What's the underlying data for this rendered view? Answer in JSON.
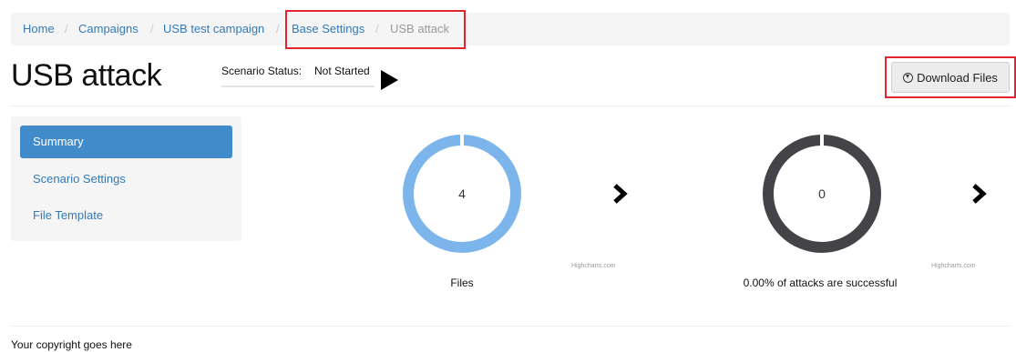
{
  "breadcrumb": {
    "items": [
      "Home",
      "Campaigns",
      "USB test campaign",
      "Base Settings",
      "USB attack"
    ],
    "separator": "/"
  },
  "header": {
    "title": "USB attack",
    "status_label": "Scenario Status:",
    "status_value": "Not Started",
    "download_label": "Download Files"
  },
  "sidebar": {
    "items": [
      {
        "label": "Summary",
        "active": true
      },
      {
        "label": "Scenario Settings",
        "active": false
      },
      {
        "label": "File Template",
        "active": false
      }
    ]
  },
  "charts": [
    {
      "value": "4",
      "caption": "Files",
      "credits": "Highcharts.com",
      "color": "#7cb5ec"
    },
    {
      "value": "0",
      "caption": "0.00% of attacks are successful",
      "credits": "Highcharts.com",
      "color": "#434348"
    }
  ],
  "chart_data": [
    {
      "type": "pie",
      "categories": [
        "Files"
      ],
      "values": [
        4
      ],
      "title": "",
      "center_label": "4"
    },
    {
      "type": "pie",
      "categories": [
        "attacks"
      ],
      "values": [
        0
      ],
      "title": "",
      "center_label": "0"
    }
  ],
  "colors": {
    "link": "#337ab7",
    "active_nav": "#428bca",
    "highlight": "#e3262d"
  },
  "footer": {
    "text": "Your copyright goes here"
  }
}
